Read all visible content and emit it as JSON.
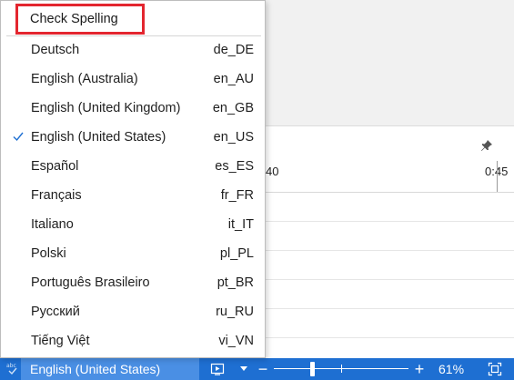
{
  "timeline": {
    "ruler_labels": [
      "40",
      "0:45"
    ]
  },
  "menu": {
    "header_label": "Check Spelling",
    "selected_code": "en_US",
    "check_color": "#1e6fd2",
    "items": [
      {
        "name": "Deutsch",
        "code": "de_DE"
      },
      {
        "name": "English (Australia)",
        "code": "en_AU"
      },
      {
        "name": "English (United Kingdom)",
        "code": "en_GB"
      },
      {
        "name": "English (United States)",
        "code": "en_US"
      },
      {
        "name": "Español",
        "code": "es_ES"
      },
      {
        "name": "Français",
        "code": "fr_FR"
      },
      {
        "name": "Italiano",
        "code": "it_IT"
      },
      {
        "name": "Polski",
        "code": "pl_PL"
      },
      {
        "name": "Português Brasileiro",
        "code": "pt_BR"
      },
      {
        "name": "Русский",
        "code": "ru_RU"
      },
      {
        "name": "Tiếng Việt",
        "code": "vi_VN"
      }
    ]
  },
  "statusbar": {
    "language_label": "English (United States)",
    "zoom_percent": 61,
    "zoom_level": "61%",
    "accent_color": "#1e6fd2"
  }
}
